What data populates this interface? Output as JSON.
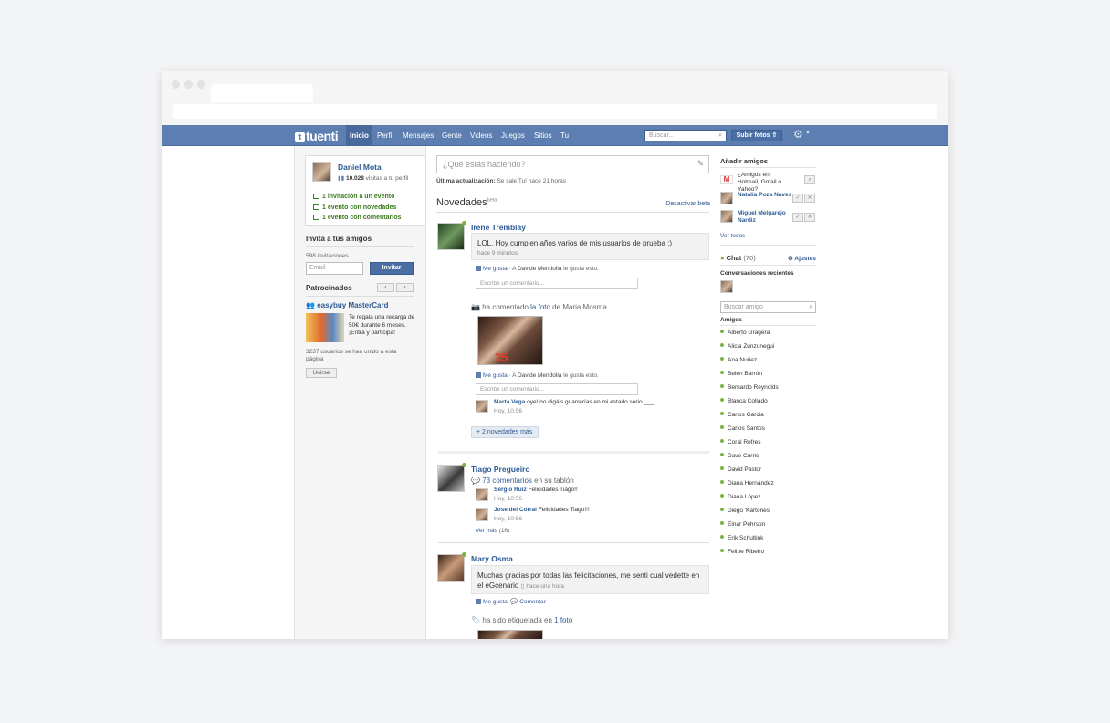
{
  "nav": {
    "logo": "tuenti",
    "links": [
      "Inicio",
      "Perfil",
      "Mensajes",
      "Gente",
      "Videos",
      "Juegos",
      "Sitios",
      "Tu"
    ],
    "search_placeholder": "Buscar...",
    "upload": "Subir fotos"
  },
  "profile": {
    "name": "Daniel Mota",
    "visits_count": "10.028",
    "visits_label": "visitas a tu perfil",
    "events": [
      "1 invitación a un evento",
      "1 evento con novedades",
      "1 evento con comentarios"
    ]
  },
  "invite": {
    "title": "Invita a tus amigos",
    "count": "598 invitaciones",
    "email_placeholder": "Email",
    "button": "Invitar"
  },
  "sponsored": {
    "title": "Patrocinados",
    "prev": "‹",
    "next": "›",
    "ad_title": "easybuy MasterCard",
    "ad_text": "Te regala una recarga de 50€ durante 6 meses. ¡Entra y participa!",
    "joined": "3237 usuarios se han unido a esta página",
    "join_button": "Unirse"
  },
  "status": {
    "placeholder": "¿Qué estás haciendo?",
    "last_label": "Última actualización:",
    "last_text": "Se sale Tu!",
    "last_time": "hace 21 horas"
  },
  "feed": {
    "title": "Novedades",
    "beta": "beta",
    "deactivate": "Desactivar beta",
    "comment_placeholder": "Escribe un comentario...",
    "like": "Me gusta",
    "irene": {
      "name": "Irene Tremblay",
      "text": "LOL. Hoy cumplen años varios de mis usuarios de prueba :)",
      "time": "hace 9 minutos",
      "likes_prefix": "A",
      "likes_name": "Davide Mendolia",
      "likes_suffix": "le gusta esto.",
      "commented_prefix": "ha comentado",
      "commented_link": "la foto",
      "commented_of": "de",
      "commented_owner": "Maria Mosma",
      "photo_number": "25",
      "reply_name": "Marta Vega",
      "reply_text": "oye! no digáis guarrerías en mi estado serio ___.",
      "reply_time": "Hoy, 10:56",
      "more": "+ 2 novedades más"
    },
    "tiago": {
      "name": "Tiago Pregueiro",
      "comments_link": "73 comentarios",
      "comments_suffix": "en su tablón",
      "c1_name": "Sergio Ruiz",
      "c1_text": "Felicidades Tiago!!",
      "c1_time": "Hoy, 10:56",
      "c2_name": "Jose del Corral",
      "c2_text": "Felicidades Tiago!!!",
      "c2_time": "Hoy, 10:56",
      "see_more": "Ver más",
      "see_more_count": "(16)"
    },
    "mary": {
      "name": "Mary Osma",
      "text": "Muchas gracias por todas las felicitaciones, me senti cual vedette en el eGcenario",
      "time": "hace una hora",
      "comment": "Comentar",
      "tagged_prefix": "ha sido etiquetada en",
      "tagged_link": "1 foto"
    }
  },
  "right": {
    "add_friends": "Añadir amigos",
    "hotmail": "¿Amigos en Hotmail, Gmail o Yahoo?",
    "suggest1": "Natalia Poza Naves",
    "suggest2": "Miguel Melgarejo Nardiz",
    "see_all": "Ver todos",
    "chat": "Chat",
    "chat_count": "(70)",
    "settings": "Ajustes",
    "recent": "Conversaciones recientes",
    "search_friend": "Buscar amigo",
    "friends_title": "Amigos",
    "friends": [
      "Alberto Gragera",
      "Alicia Zunzunegui",
      "Ana Nuñez",
      "Belén Barrón",
      "Bernardo Reynolds",
      "Blanca Collado",
      "Carlos Garcia",
      "Carlos Santos",
      "Coral Rofres",
      "Dave Currie",
      "David Pastor",
      "Diana Hernández",
      "Diana López",
      "Diego 'Kartones'",
      "Einar Pehrson",
      "Erik Schultink",
      "Felipe Ribeiro"
    ]
  },
  "colors": {
    "nav": "#5d7eb0",
    "link": "#2d5b96",
    "online": "#7cb342",
    "event": "#3c7a1f"
  }
}
